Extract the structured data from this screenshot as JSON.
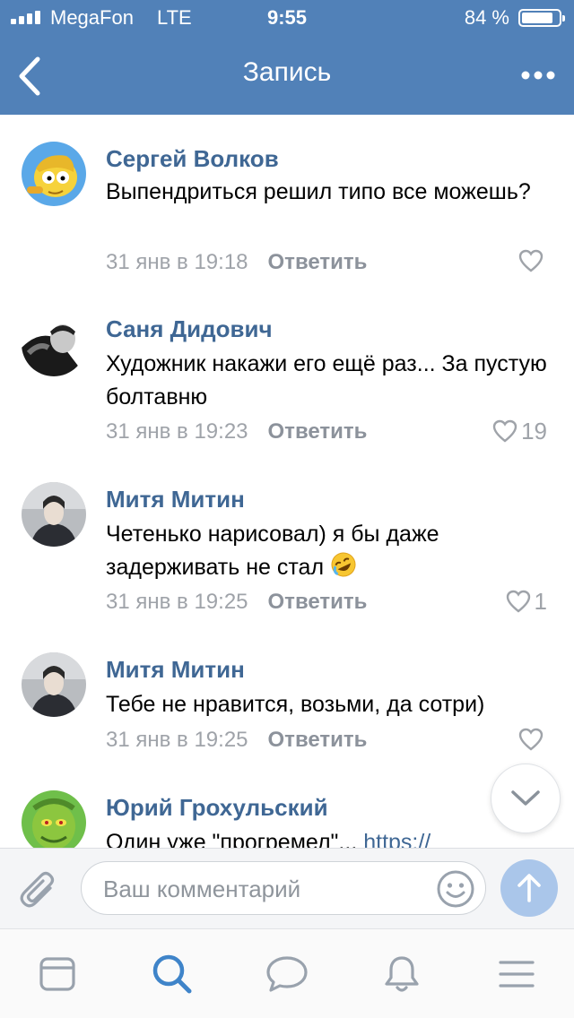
{
  "status_bar": {
    "carrier": "MegaFon",
    "network": "LTE",
    "time": "9:55",
    "battery_percent": "84 %",
    "battery_level": 0.84
  },
  "nav": {
    "title": "Запись",
    "back_icon": "chevron-left-icon",
    "more_icon": "more-dots-icon"
  },
  "comments": [
    {
      "author": "Сергей Волков",
      "text": "Выпендриться решил типо все можешь?",
      "date": "31 янв в 19:18",
      "reply_label": "Ответить",
      "likes": ""
    },
    {
      "author": "Саня Дидович",
      "text": "Художник накажи его ещё раз... За пустую болтавню",
      "date": "31 янв в 19:23",
      "reply_label": "Ответить",
      "likes": "19"
    },
    {
      "author": "Митя Митин",
      "text": "Четенько нарисовал) я бы даже задерживать не стал",
      "date": "31 янв в 19:25",
      "reply_label": "Ответить",
      "likes": "1",
      "emoji": "rofl-emoji-icon"
    },
    {
      "author": "Митя Митин",
      "text": "Тебе не нравится, возьми, да сотри)",
      "date": "31 янв в 19:25",
      "reply_label": "Ответить",
      "likes": ""
    },
    {
      "author": "Юрий Грохульский",
      "text": "Один уже \"прогремел\"...",
      "link": "https://",
      "date": "",
      "reply_label": "",
      "likes": ""
    }
  ],
  "composer": {
    "placeholder": "Ваш комментарий",
    "attach_icon": "paperclip-icon",
    "emoji_icon": "smile-icon",
    "send_icon": "send-arrow-icon"
  },
  "tabs": [
    {
      "icon": "news-feed-icon",
      "active": false
    },
    {
      "icon": "search-icon",
      "active": true
    },
    {
      "icon": "messages-icon",
      "active": false
    },
    {
      "icon": "notifications-bell-icon",
      "active": false
    },
    {
      "icon": "menu-icon",
      "active": false
    }
  ],
  "colors": {
    "header": "#5181b8",
    "author_name": "#3f6794",
    "meta_text": "#9fa3a9",
    "active_tab": "#3f84c9",
    "inactive_tab": "#99a2ad",
    "send_button": "#aac6ea"
  }
}
